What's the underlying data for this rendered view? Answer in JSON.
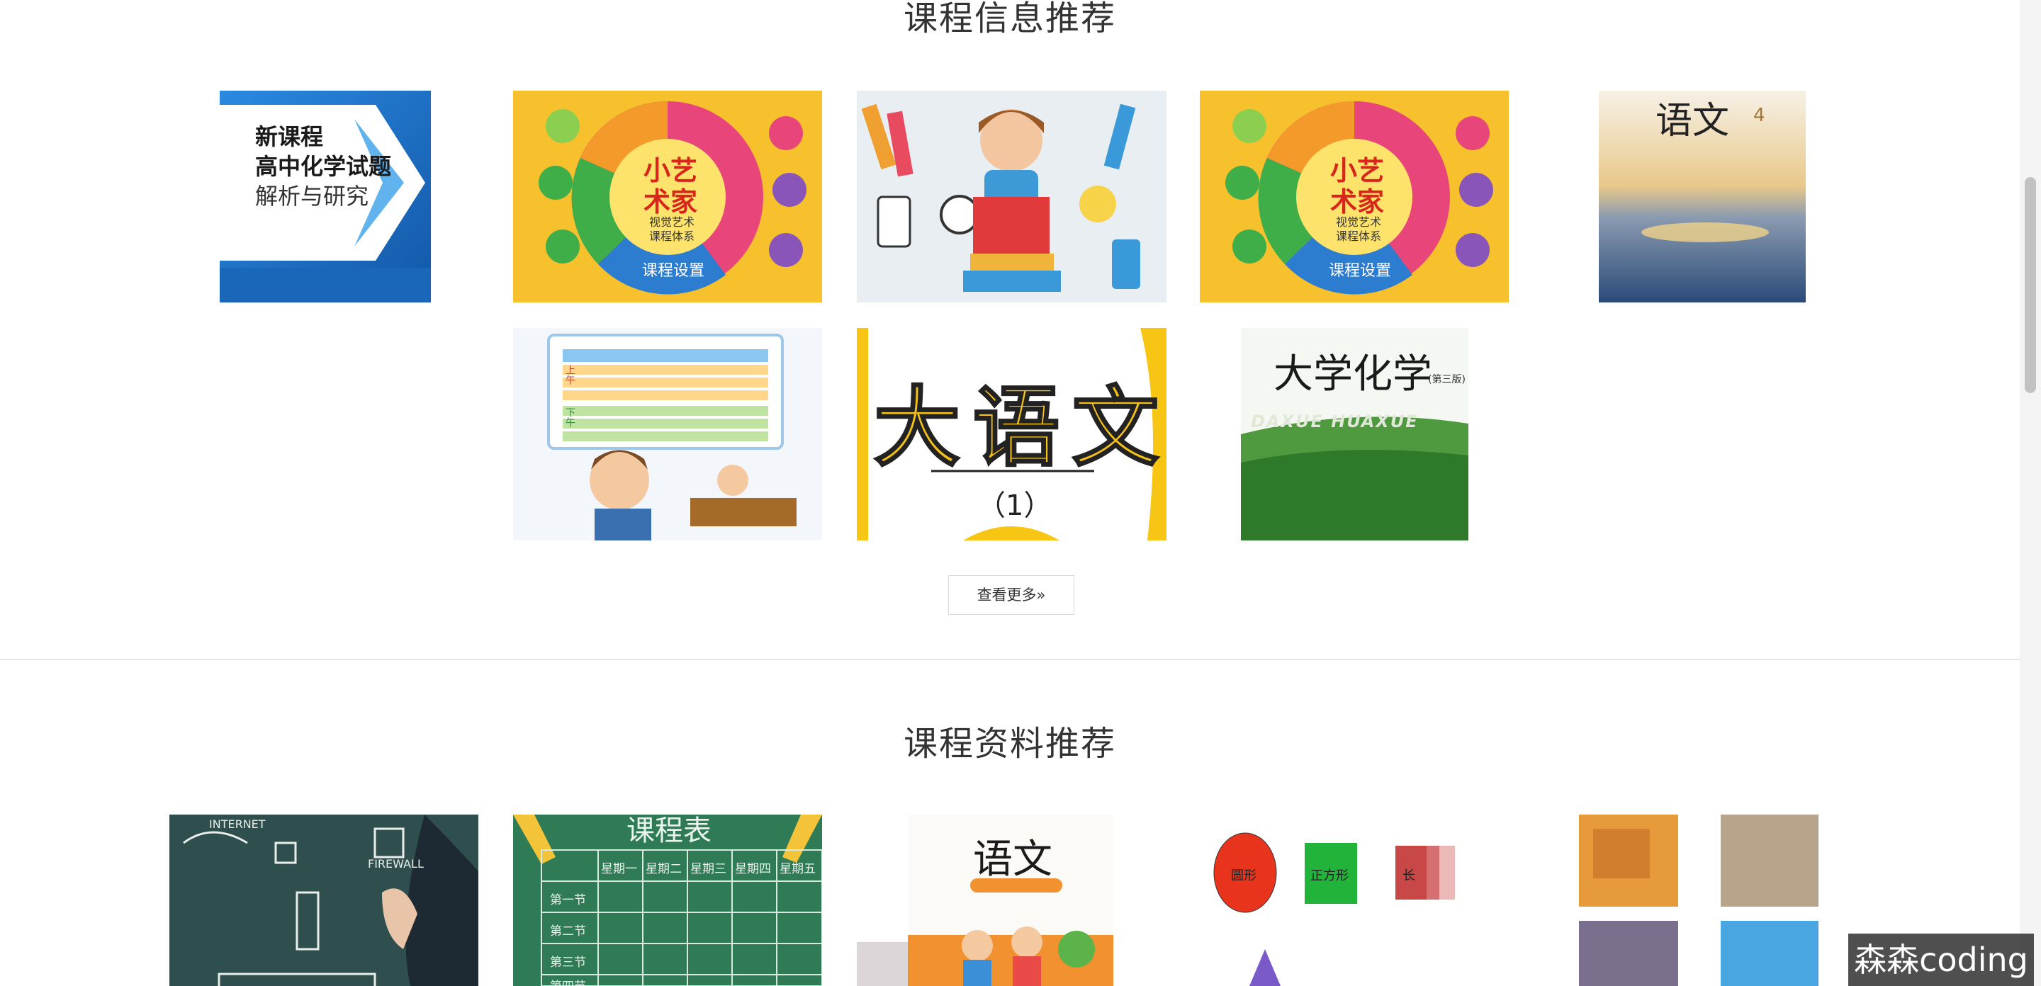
{
  "sections": {
    "course_info": {
      "title": "课程信息推荐",
      "more_label": "查看更多»"
    },
    "course_materials": {
      "title": "课程资料推荐"
    }
  },
  "covers": {
    "chem_book": {
      "line1": "新课程",
      "line2": "高中化学试题",
      "line3": "解析与研究"
    },
    "art_wheel": {
      "line1": "小艺",
      "line2": "术家",
      "sub1": "视觉艺术",
      "sub2": "课程体系",
      "footer": "课程设置"
    },
    "yuwen4": {
      "title": "语文",
      "num": "4"
    },
    "dayuwen": {
      "title": "大语文",
      "sub": "（1）"
    },
    "daxue_huaxue": {
      "title": "大学化学",
      "edition": "(第三版)",
      "pinyin": "DAXUE HUAXUE"
    },
    "schedule": {
      "top": "上午",
      "bottom": "下午"
    },
    "chalk_board": {
      "word1": "INTERNET",
      "word2": "FIREWALL"
    },
    "green_board": {
      "title": "课程表",
      "h1": "星期一",
      "h2": "星期二",
      "h3": "星期三",
      "h4": "星期四",
      "h5": "星期五",
      "r1": "第一节",
      "r2": "第二节",
      "r3": "第三节",
      "r4": "第四节"
    },
    "yuwen_grade": {
      "title": "语文"
    },
    "shapes": {
      "circle": "圆形",
      "square": "正方形",
      "rect": "长"
    }
  },
  "watermark": "森森coding"
}
